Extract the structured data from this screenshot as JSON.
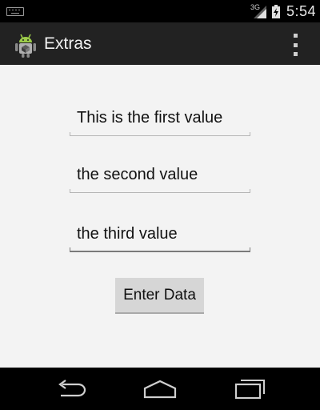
{
  "status_bar": {
    "time": "5:54",
    "network_type": "3G",
    "icons": [
      "keyboard-icon",
      "signal-icon",
      "battery-charging-icon"
    ]
  },
  "action_bar": {
    "title": "Extras",
    "icon": "android-app-icon",
    "overflow_icon": "overflow-menu-icon"
  },
  "form": {
    "fields": [
      {
        "value": "This is the first value"
      },
      {
        "value": "the second value"
      },
      {
        "value": "the third value"
      }
    ],
    "submit_label": "Enter Data"
  },
  "nav_bar": {
    "icons": [
      "back-icon",
      "home-icon",
      "recent-apps-icon"
    ]
  },
  "colors": {
    "action_bar": "#222222",
    "content_background": "#f3f3f3",
    "button": "#d6d6d6"
  }
}
